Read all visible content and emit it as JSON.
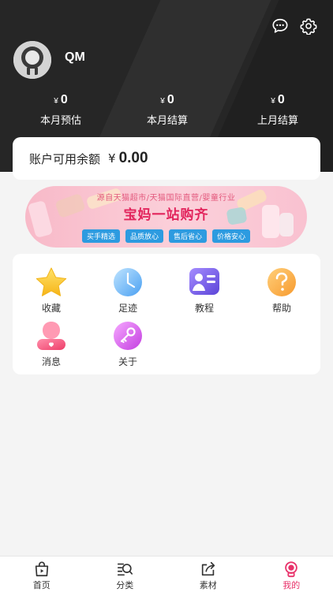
{
  "user": {
    "name": "QM"
  },
  "stats": [
    {
      "currency": "¥",
      "value": "0",
      "label": "本月预估"
    },
    {
      "currency": "¥",
      "value": "0",
      "label": "本月结算"
    },
    {
      "currency": "¥",
      "value": "0",
      "label": "上月结算"
    }
  ],
  "balance": {
    "label": "账户可用余额",
    "currency": "¥",
    "amount": "0.00"
  },
  "banner": {
    "subtitle": "源自天猫超市/天猫国际直营/婴童行业",
    "title": "宝妈一站购齐",
    "tags": [
      "买手精选",
      "品质放心",
      "售后省心",
      "价格安心"
    ]
  },
  "menu": [
    {
      "label": "收藏",
      "icon": "star-icon"
    },
    {
      "label": "足迹",
      "icon": "clock-icon"
    },
    {
      "label": "教程",
      "icon": "tutorial-icon"
    },
    {
      "label": "帮助",
      "icon": "help-icon"
    },
    {
      "label": "消息",
      "icon": "message-icon"
    },
    {
      "label": "关于",
      "icon": "key-icon"
    }
  ],
  "tabs": [
    {
      "label": "首页",
      "icon": "home-bag-icon"
    },
    {
      "label": "分类",
      "icon": "category-search-icon"
    },
    {
      "label": "素材",
      "icon": "share-icon"
    },
    {
      "label": "我的",
      "icon": "profile-icon",
      "active": true
    }
  ],
  "colors": {
    "accent": "#e8326a",
    "header_bg": "#262626",
    "tag_blue": "#2d9be0"
  }
}
